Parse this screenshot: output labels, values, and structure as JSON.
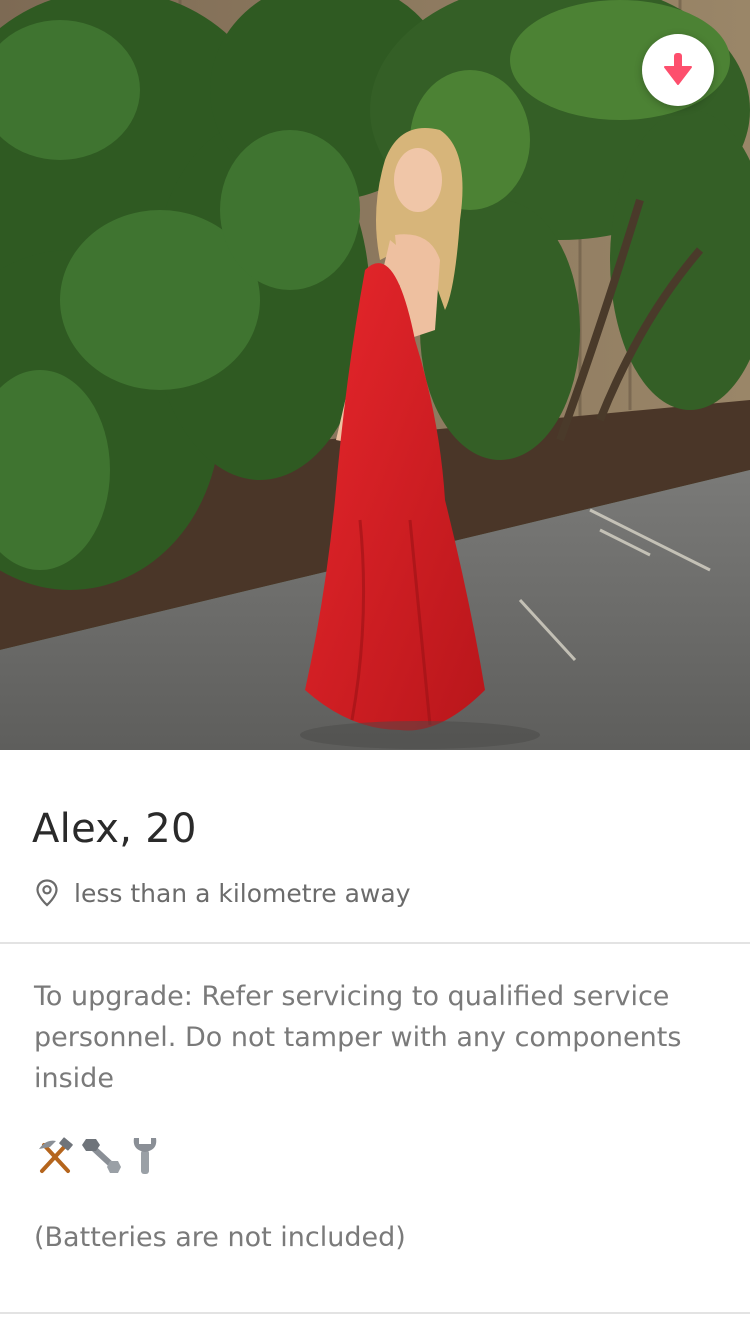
{
  "profile": {
    "photo_alt": "Profile photo",
    "collapse_icon": "arrow-down-icon",
    "name_age": "Alex, 20",
    "distance_icon": "location-pin-icon",
    "distance": "less than a kilometre away",
    "bio": "To upgrade: Refer servicing to qualified service personnel. Do not tamper with any components inside",
    "tool_emojis": [
      "hammer-and-pick-icon",
      "nut-and-bolt-icon",
      "wrench-icon"
    ],
    "note": "(Batteries are not included)"
  },
  "colors": {
    "accent": "#fd4f6d",
    "text_primary": "#2a2a2a",
    "text_secondary": "#7a7a7a",
    "divider": "#e3e3e3"
  }
}
